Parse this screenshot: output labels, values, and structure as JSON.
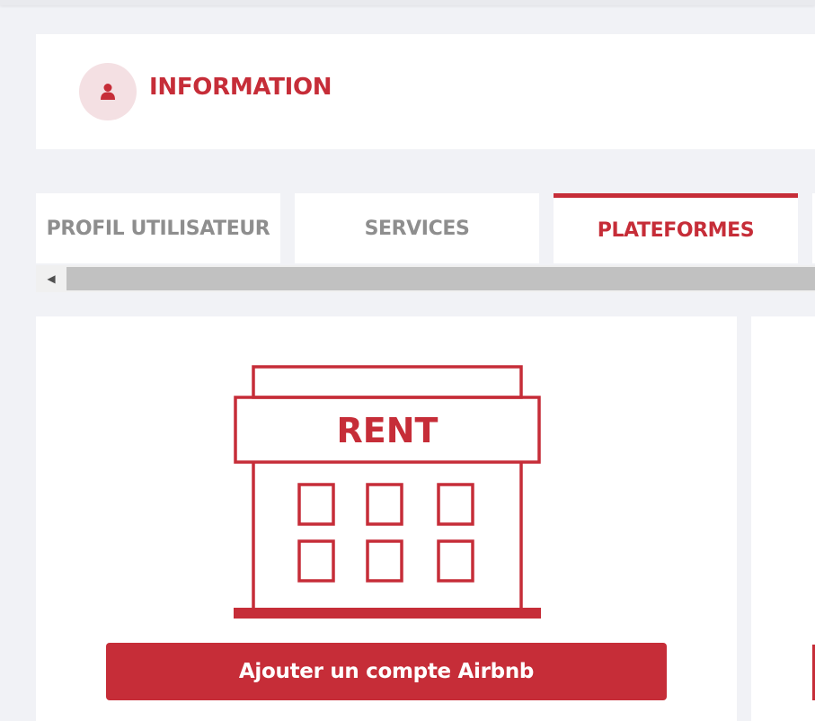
{
  "header": {
    "title": "INFORMATION",
    "icon": "user-icon"
  },
  "tabs": [
    {
      "label": "PROFIL UTILISATEUR",
      "active": false
    },
    {
      "label": "SERVICES",
      "active": false
    },
    {
      "label": "PLATEFORMES",
      "active": true
    }
  ],
  "platform_card": {
    "illustration": "rent-building-icon",
    "sign_text": "RENT",
    "button_label": "Ajouter un compte Airbnb"
  },
  "colors": {
    "accent": "#c62d38",
    "background": "#f1f2f6",
    "tab_inactive_text": "#8e8e8e",
    "scroll_thumb": "#c1c1c1"
  }
}
